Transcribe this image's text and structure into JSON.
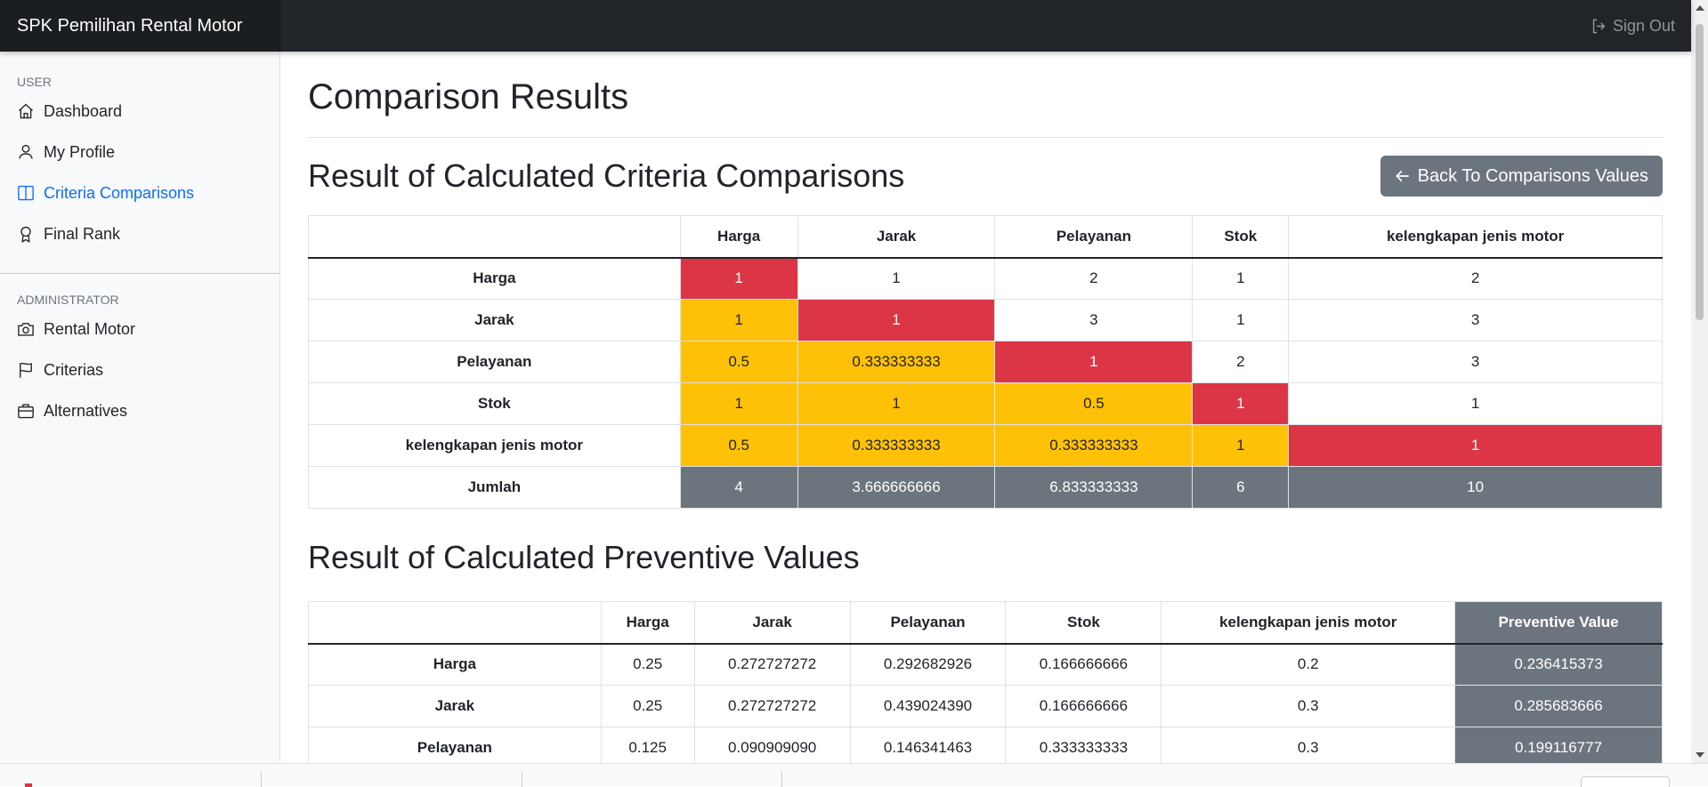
{
  "navbar": {
    "brand": "SPK Pemilihan Rental Motor",
    "signout_label": "Sign Out"
  },
  "sidebar": {
    "user_heading": "USER",
    "user_items": [
      {
        "label": "Dashboard",
        "icon": "house-icon"
      },
      {
        "label": "My Profile",
        "icon": "person-icon"
      },
      {
        "label": "Criteria Comparisons",
        "icon": "columns-icon",
        "active": true
      },
      {
        "label": "Final Rank",
        "icon": "award-icon"
      }
    ],
    "admin_heading": "ADMINISTRATOR",
    "admin_items": [
      {
        "label": "Rental Motor",
        "icon": "camera-icon"
      },
      {
        "label": "Criterias",
        "icon": "flag-icon"
      },
      {
        "label": "Alternatives",
        "icon": "briefcase-icon"
      }
    ]
  },
  "main": {
    "page_title": "Comparison Results",
    "criteria_section_title": "Result of Calculated Criteria Comparisons",
    "back_button_label": "Back To Comparisons Values",
    "preventive_section_title": "Result of Calculated Preventive Values"
  },
  "criteria_table": {
    "headers": [
      "",
      "Harga",
      "Jarak",
      "Pelayanan",
      "Stok",
      "kelengkapan jenis motor"
    ],
    "rows": [
      {
        "label": "Harga",
        "cells": [
          "1",
          "1",
          "2",
          "1",
          "2"
        ]
      },
      {
        "label": "Jarak",
        "cells": [
          "1",
          "1",
          "3",
          "1",
          "3"
        ]
      },
      {
        "label": "Pelayanan",
        "cells": [
          "0.5",
          "0.333333333",
          "1",
          "2",
          "3"
        ]
      },
      {
        "label": "Stok",
        "cells": [
          "1",
          "1",
          "0.5",
          "1",
          "1"
        ]
      },
      {
        "label": "kelengkapan jenis motor",
        "cells": [
          "0.5",
          "0.333333333",
          "0.333333333",
          "1",
          "1"
        ]
      }
    ],
    "total": {
      "label": "Jumlah",
      "cells": [
        "4",
        "3.666666666",
        "6.833333333",
        "6",
        "10"
      ]
    }
  },
  "preventive_table": {
    "headers": [
      "",
      "Harga",
      "Jarak",
      "Pelayanan",
      "Stok",
      "kelengkapan jenis motor",
      "Preventive Value"
    ],
    "rows": [
      {
        "label": "Harga",
        "cells": [
          "0.25",
          "0.272727272",
          "0.292682926",
          "0.166666666",
          "0.2",
          "0.236415373"
        ]
      },
      {
        "label": "Jarak",
        "cells": [
          "0.25",
          "0.272727272",
          "0.439024390",
          "0.166666666",
          "0.3",
          "0.285683666"
        ]
      },
      {
        "label": "Pelayanan",
        "cells": [
          "0.125",
          "0.090909090",
          "0.146341463",
          "0.333333333",
          "0.3",
          "0.199116777"
        ]
      }
    ]
  },
  "colors": {
    "diagonal": "#dc3545",
    "lower_triangle": "#ffc107",
    "total_row": "#6c757d",
    "active_link": "#0d6efd"
  }
}
